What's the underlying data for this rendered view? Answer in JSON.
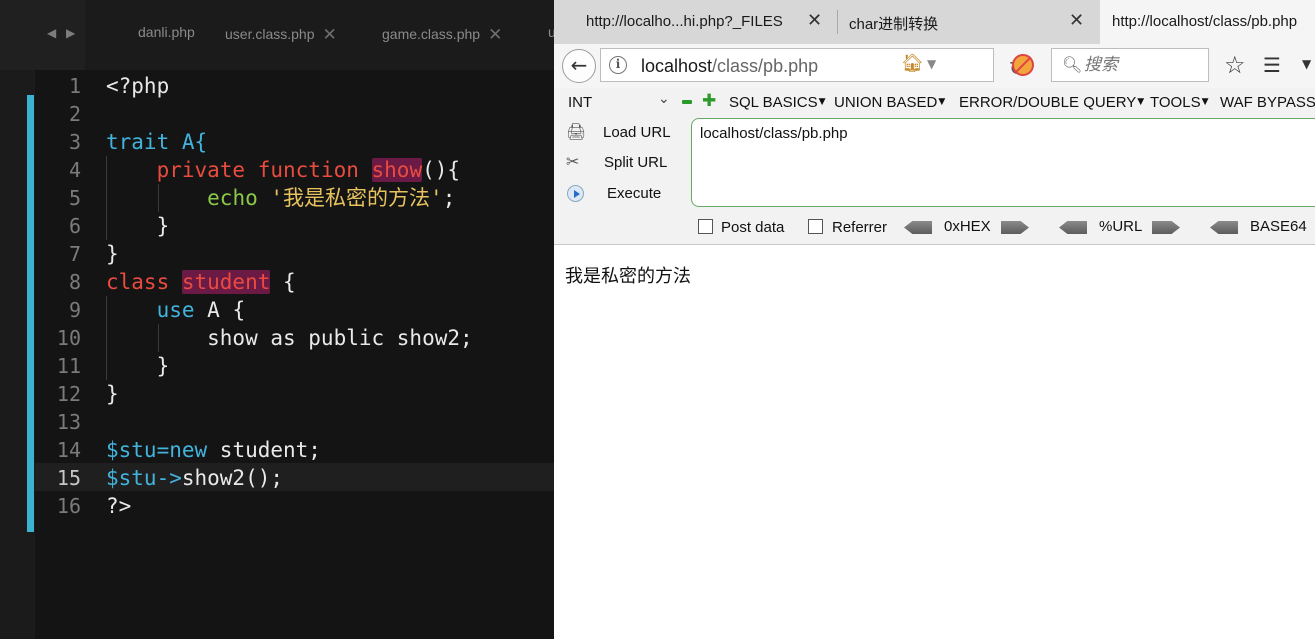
{
  "editor": {
    "tabs": [
      {
        "label": "danli.php",
        "closable": false
      },
      {
        "label": "user.class.php",
        "closable": true
      },
      {
        "label": "game.class.php",
        "closable": true
      },
      {
        "label": "u",
        "closable": false
      }
    ],
    "line_numbers": [
      "1",
      "2",
      "3",
      "4",
      "5",
      "6",
      "7",
      "8",
      "9",
      "10",
      "11",
      "12",
      "13",
      "14",
      "15",
      "16"
    ],
    "current_line": 15,
    "code_lines": [
      [
        {
          "t": "<?php",
          "c": "def"
        }
      ],
      [],
      [
        {
          "t": "trait A{",
          "c": "blue"
        }
      ],
      [
        {
          "t": "    ",
          "c": "def"
        },
        {
          "t": "private function ",
          "c": "red"
        },
        {
          "t": "show",
          "c": "red",
          "hl": true
        },
        {
          "t": "(){",
          "c": "def"
        }
      ],
      [
        {
          "t": "        ",
          "c": "def"
        },
        {
          "t": "echo",
          "c": "green"
        },
        {
          "t": " ",
          "c": "def"
        },
        {
          "t": "'我是私密的方法'",
          "c": "str"
        },
        {
          "t": ";",
          "c": "def"
        }
      ],
      [
        {
          "t": "    }",
          "c": "def"
        }
      ],
      [
        {
          "t": "}",
          "c": "def"
        }
      ],
      [
        {
          "t": "class ",
          "c": "red"
        },
        {
          "t": "student",
          "c": "red",
          "hl": true
        },
        {
          "t": " {",
          "c": "def"
        }
      ],
      [
        {
          "t": "    ",
          "c": "def"
        },
        {
          "t": "use",
          "c": "blue"
        },
        {
          "t": " A {",
          "c": "def"
        }
      ],
      [
        {
          "t": "        show as public show2;",
          "c": "def"
        }
      ],
      [
        {
          "t": "    }",
          "c": "def"
        }
      ],
      [
        {
          "t": "}",
          "c": "def"
        }
      ],
      [],
      [
        {
          "t": "$stu=new",
          "c": "blue"
        },
        {
          "t": " student;",
          "c": "def"
        }
      ],
      [
        {
          "t": "$stu->",
          "c": "blue"
        },
        {
          "t": "show2();",
          "c": "def"
        }
      ],
      [
        {
          "t": "?>",
          "c": "def"
        }
      ]
    ]
  },
  "browser": {
    "tabs": [
      {
        "label": "http://localho...hi.php?_FILES",
        "active": false
      },
      {
        "label": "char进制转换",
        "active": false
      },
      {
        "label": "http://localhost/class/pb.php",
        "active": true
      }
    ],
    "url": {
      "host": "localhost",
      "path": "/class/pb.php"
    },
    "search": {
      "placeholder": "搜索"
    },
    "hackbar": {
      "type_select": "INT",
      "menus": [
        "SQL BASICS",
        "UNION BASED",
        "ERROR/DOUBLE QUERY",
        "TOOLS",
        "WAF BYPASS"
      ],
      "buttons": {
        "load": "Load URL",
        "split": "Split URL",
        "execute": "Execute"
      },
      "textarea": "localhost/class/pb.php",
      "options": {
        "post": "Post data",
        "referrer": "Referrer"
      },
      "encoders": [
        "0xHEX",
        "%URL",
        "BASE64"
      ]
    },
    "page_text": "我是私密的方法"
  }
}
